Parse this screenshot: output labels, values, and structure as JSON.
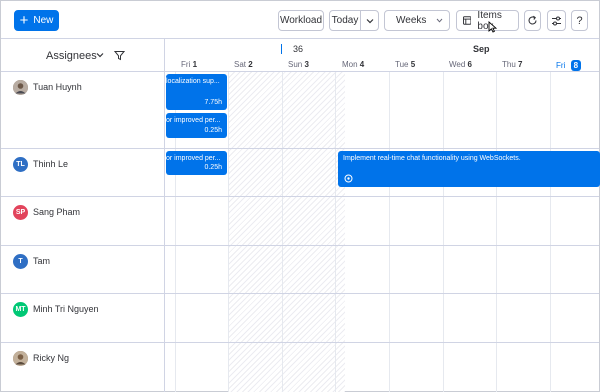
{
  "toolbar": {
    "new_label": "New",
    "workload_label": "Workload",
    "today_label": "Today",
    "view_select_value": "Weeks",
    "items_box_label": "Items box"
  },
  "assignees_header": {
    "label": "Assignees"
  },
  "timeline": {
    "week_number": "36",
    "month": "Sep",
    "days": [
      {
        "name": "Fri",
        "num": "1"
      },
      {
        "name": "Sat",
        "num": "2"
      },
      {
        "name": "Sun",
        "num": "3"
      },
      {
        "name": "Mon",
        "num": "4"
      },
      {
        "name": "Tue",
        "num": "5"
      },
      {
        "name": "Wed",
        "num": "6"
      },
      {
        "name": "Thu",
        "num": "7"
      },
      {
        "name": "Fri",
        "num": "8"
      }
    ]
  },
  "people": [
    {
      "name": "Tuan Huynh",
      "initials": "",
      "avatar_color": "#8a7a6a"
    },
    {
      "name": "Thinh Le",
      "initials": "TL",
      "avatar_color": "#2f6fc4"
    },
    {
      "name": "Sang Pham",
      "initials": "SP",
      "avatar_color": "#e2445c"
    },
    {
      "name": "Tam",
      "initials": "T",
      "avatar_color": "#2f6fc4"
    },
    {
      "name": "Minh Tri Nguyen",
      "initials": "MT",
      "avatar_color": "#00c875"
    },
    {
      "name": "Ricky Ng",
      "initials": "",
      "avatar_color": "#9c8770"
    }
  ],
  "tasks": [
    {
      "title": "localization sup...",
      "hours": "7.75h"
    },
    {
      "title": "or improved per...",
      "hours": "0.25h"
    },
    {
      "title": "or improved per...",
      "hours": "0.25h"
    },
    {
      "title": "Implement real-time chat functionality using WebSockets.",
      "hours": ""
    }
  ],
  "colors": {
    "accent": "#0073ea",
    "border": "#d0d4e4"
  }
}
